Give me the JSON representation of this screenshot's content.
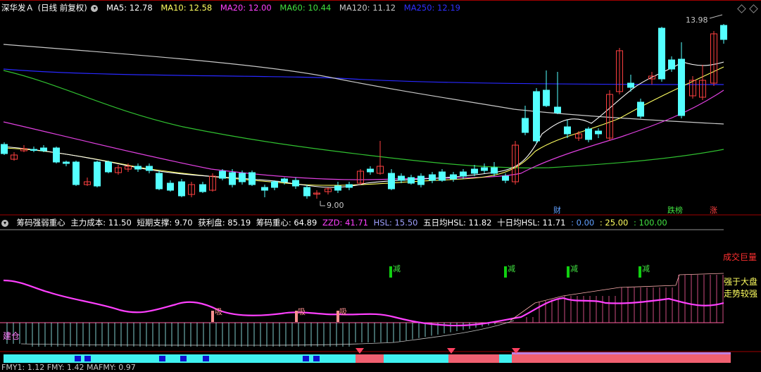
{
  "main_header": {
    "stock_name": "深华发Ａ",
    "period": "(日线 前复权)",
    "ma5": "MA5: 12.78",
    "ma10": "MA10: 12.58",
    "ma20": "MA20: 12.00",
    "ma60": "MA60: 10.44",
    "ma120": "MA120: 11.12",
    "ma250": "MA250: 12.19"
  },
  "price_labels": {
    "high": "13.98",
    "low": "9.00"
  },
  "event_tags": {
    "cai": "财",
    "diebang": "跌榜",
    "zhang": "涨"
  },
  "indicator_header": {
    "name": "筹码强弱重心",
    "main_cost": "主力成本: 11.50",
    "short_support": "短期支撑: 9.70",
    "profit": "获利盘: 85.19",
    "chip_center": "筹码重心: 64.89",
    "zzd": "ZZD: 41.71",
    "hsl": "HSL: 15.50",
    "hsl5": "五日均HSL: 11.82",
    "hsl10": "十日均HSL: 11.71",
    "v1": ": 0.00",
    "v2": ": 25.00",
    "v3": ": 100.00"
  },
  "indicator_labels": {
    "volume_huge": "成交巨量",
    "strong1": "强于大盘",
    "strong2": "走势较强",
    "jiancang": "建仓",
    "jian": "减",
    "xi": "吸"
  },
  "bottom_header": {
    "text": "FMY1: 1.12 FMY: 1.42 MAFMY: 0.97"
  },
  "colors": {
    "up": "#ff4040",
    "down": "#54ffff",
    "ma5": "#ffffff",
    "ma10": "#ffff60",
    "ma20": "#ff40ff",
    "ma60": "#40d040",
    "ma120": "#c0c0c0",
    "ma250": "#2020ff"
  }
}
